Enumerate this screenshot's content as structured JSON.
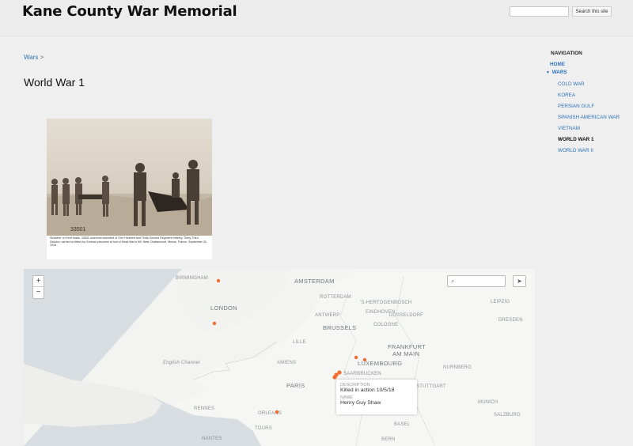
{
  "header": {
    "site_title": "Kane County War Memorial",
    "search_placeholder": "",
    "search_button": "Search this site"
  },
  "breadcrumb": {
    "link": "Wars",
    "separator": ">"
  },
  "page": {
    "title": "World War 1"
  },
  "photo": {
    "stamp": "33501",
    "caption": "Stretcher on front roads. 33501 American wounded of One Hundred and Thirty-Second Regiment Infantry, Thirty-Third Division, carried on litters by German prisoners at foot of Dead Man's Hill, Near Chattancourt, Meuse, France. September 26, 1918"
  },
  "map": {
    "zoom_in": "+",
    "zoom_out": "−",
    "search_icon": "magnifier-icon",
    "share_icon": "send-icon",
    "cities": [
      {
        "name": "BIRMINGHAM",
        "size": "small"
      },
      {
        "name": "LONDON",
        "size": "big"
      },
      {
        "name": "AMSTERDAM",
        "size": "big"
      },
      {
        "name": "ROTTERDAM",
        "size": "small"
      },
      {
        "name": "'S-HERTOGENBOSCH",
        "size": "small"
      },
      {
        "name": "EINDHOVEN",
        "size": "small"
      },
      {
        "name": "ANTWERP",
        "size": "small"
      },
      {
        "name": "BRUSSELS",
        "size": "big"
      },
      {
        "name": "COLOGNE",
        "size": "small"
      },
      {
        "name": "DUSSELDORF",
        "size": "small"
      },
      {
        "name": "FRANKFURT",
        "size": "big"
      },
      {
        "name": "AM MAIN",
        "size": "big"
      },
      {
        "name": "LUXEMBOURG",
        "size": "big"
      },
      {
        "name": "SAARBRUCKEN",
        "size": "small"
      },
      {
        "name": "NURNBERG",
        "size": "small"
      },
      {
        "name": "STUTTGART",
        "size": "small"
      },
      {
        "name": "PARIS",
        "size": "big"
      },
      {
        "name": "ORLEANS",
        "size": "small"
      },
      {
        "name": "TOURS",
        "size": "small"
      },
      {
        "name": "RENNES",
        "size": "small"
      },
      {
        "name": "NANTES",
        "size": "small"
      },
      {
        "name": "BASEL",
        "size": "small"
      },
      {
        "name": "BERN",
        "size": "small"
      },
      {
        "name": "MUNICH",
        "size": "small"
      },
      {
        "name": "SALZBURG",
        "size": "small"
      },
      {
        "name": "LEIPZIG",
        "size": "small"
      },
      {
        "name": "DRESDEN",
        "size": "small"
      },
      {
        "name": "AMIENS",
        "size": "small"
      },
      {
        "name": "LILLE",
        "size": "small"
      },
      {
        "name": "English Channel",
        "size": "small"
      }
    ],
    "popup": {
      "description_label": "DESCRIPTION",
      "description_value": "Killed in action 10/5/18",
      "name_label": "NAME",
      "name_value": "Henry Guy Shaw"
    },
    "marker_color": "#f26d2e"
  },
  "nav": {
    "heading": "NAVIGATION",
    "home": "HOME",
    "wars": "WARS",
    "items": [
      "COLD WAR",
      "KOREA",
      "PERSIAN GULF",
      "SPANISH AMERICAN WAR",
      "VIETNAM",
      "WORLD WAR 1",
      "WORLD WAR II"
    ],
    "active": "WORLD WAR 1"
  }
}
